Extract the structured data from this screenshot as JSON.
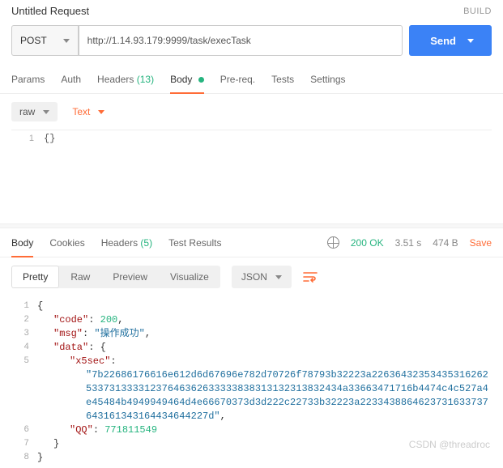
{
  "header": {
    "title": "Untitled Request",
    "build": "BUILD"
  },
  "request": {
    "method": "POST",
    "url": "http://1.14.93.179:9999/task/execTask",
    "send": "Send"
  },
  "tabs": {
    "params": "Params",
    "auth": "Auth",
    "headers": "Headers",
    "headers_count": "(13)",
    "body": "Body",
    "prereq": "Pre-req.",
    "tests": "Tests",
    "settings": "Settings"
  },
  "subbar": {
    "raw": "raw",
    "text": "Text"
  },
  "request_body": {
    "line1_num": "1",
    "line1_code": "{}"
  },
  "resp_tabs": {
    "body": "Body",
    "cookies": "Cookies",
    "headers": "Headers",
    "headers_count": "(5)",
    "test_results": "Test Results"
  },
  "resp_meta": {
    "status": "200 OK",
    "time": "3.51 s",
    "size": "474 B",
    "save": "Save"
  },
  "view": {
    "pretty": "Pretty",
    "raw": "Raw",
    "preview": "Preview",
    "visualize": "Visualize",
    "json": "JSON"
  },
  "response": {
    "l1": "{",
    "l2_key": "\"code\"",
    "l2_val": "200",
    "l3_key": "\"msg\"",
    "l3_val": "\"操作成功\"",
    "l4_key": "\"data\"",
    "l4_val": "{",
    "l5_key": "\"x5sec\"",
    "l5_val": "\"7b22686176616e612d6d67696e782d70726f78793b32223a2263643235343531626253373133331237646362633333838313132313832434a33663471716b4474c4c527a4e45484b4949949464d4e66670373d3d222c22733b32223a2233438864623731633737643161343164434644227d\"",
    "l6_key": "\"QQ\"",
    "l6_val": "771811549",
    "l7": "}",
    "l8": "}"
  },
  "watermark": "CSDN @threadroc"
}
